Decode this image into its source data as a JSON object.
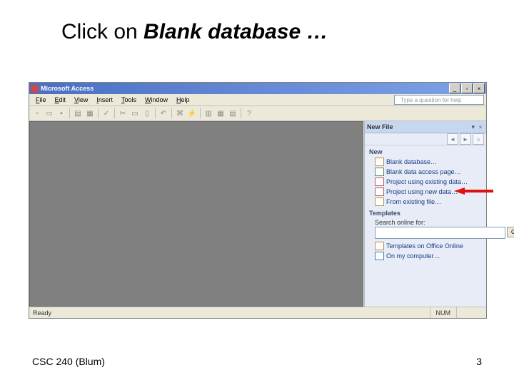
{
  "slide": {
    "title_prefix": "Click on ",
    "title_bold": "Blank database …",
    "footer_left": "CSC 240 (Blum)",
    "footer_right": "3"
  },
  "window": {
    "title": "Microsoft Access",
    "help_placeholder": "Type a question for help"
  },
  "menus": {
    "file": "File",
    "edit": "Edit",
    "view": "View",
    "insert": "Insert",
    "tools": "Tools",
    "window": "Window",
    "help": "Help"
  },
  "taskpane": {
    "title": "New File",
    "section_new": "New",
    "items_new": {
      "blank_db": "Blank database…",
      "blank_page": "Blank data access page…",
      "proj_existing": "Project using existing data…",
      "proj_new": "Project using new data…",
      "from_existing": "From existing file…"
    },
    "section_templates": "Templates",
    "search_label": "Search online for:",
    "go_label": "Go",
    "items_tpl": {
      "online": "Templates on Office Online",
      "computer": "On my computer…"
    }
  },
  "status": {
    "ready": "Ready",
    "num": "NUM"
  }
}
